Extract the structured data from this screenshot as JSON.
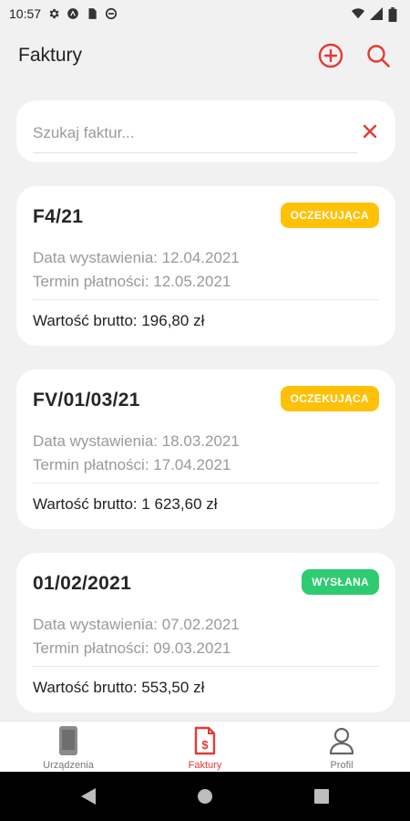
{
  "status_bar": {
    "time": "10:57",
    "icons": [
      "settings-icon",
      "notification-icon",
      "sd-card-icon",
      "sync-icon",
      "wifi-icon",
      "signal-icon",
      "battery-icon"
    ]
  },
  "app_bar": {
    "title": "Faktury",
    "actions": [
      "add-circle-icon",
      "search-icon"
    ],
    "accent_color": "#e53935"
  },
  "search": {
    "placeholder": "Szukaj faktur...",
    "value": ""
  },
  "invoices": [
    {
      "number": "F4/21",
      "status": "OCZEKUJĄCA",
      "status_color": "#ffc107",
      "issue_date": "Data wystawienia: 12.04.2021",
      "due_date": "Termin płatności: 12.05.2021",
      "total": "Wartość brutto: 196,80 zł"
    },
    {
      "number": "FV/01/03/21",
      "status": "OCZEKUJĄCA",
      "status_color": "#ffc107",
      "issue_date": "Data wystawienia: 18.03.2021",
      "due_date": "Termin płatności: 17.04.2021",
      "total": "Wartość brutto: 1 623,60 zł"
    },
    {
      "number": "01/02/2021",
      "status": "WYSŁANA",
      "status_color": "#2ecc71",
      "issue_date": "Data wystawienia: 07.02.2021",
      "due_date": "Termin płatności: 09.03.2021",
      "total": "Wartość brutto: 553,50 zł"
    }
  ],
  "bottom_nav": {
    "items": [
      {
        "label": "Urządzenia",
        "icon": "device-icon",
        "active": false
      },
      {
        "label": "Faktury",
        "icon": "invoice-icon",
        "active": true
      },
      {
        "label": "Profil",
        "icon": "profile-icon",
        "active": false
      }
    ]
  },
  "system_nav": [
    "back-icon",
    "home-icon",
    "recents-icon"
  ]
}
